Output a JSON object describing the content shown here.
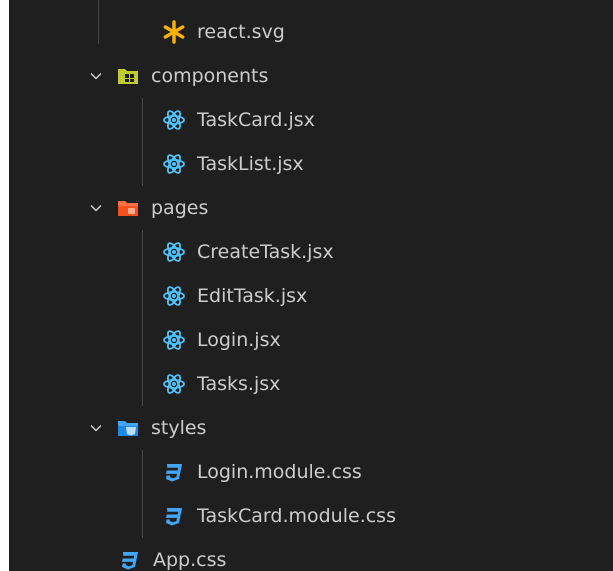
{
  "explorer": {
    "items": [
      {
        "label": "react.svg",
        "icon": "react-svg-asterisk-icon",
        "kind": "file"
      },
      {
        "label": "components",
        "icon": "folder-components-icon",
        "kind": "folder",
        "expanded": true
      },
      {
        "label": "TaskCard.jsx",
        "icon": "react-icon",
        "kind": "file"
      },
      {
        "label": "TaskList.jsx",
        "icon": "react-icon",
        "kind": "file"
      },
      {
        "label": "pages",
        "icon": "folder-pages-icon",
        "kind": "folder",
        "expanded": true
      },
      {
        "label": "CreateTask.jsx",
        "icon": "react-icon",
        "kind": "file"
      },
      {
        "label": "EditTask.jsx",
        "icon": "react-icon",
        "kind": "file"
      },
      {
        "label": "Login.jsx",
        "icon": "react-icon",
        "kind": "file"
      },
      {
        "label": "Tasks.jsx",
        "icon": "react-icon",
        "kind": "file"
      },
      {
        "label": "styles",
        "icon": "folder-styles-icon",
        "kind": "folder",
        "expanded": true
      },
      {
        "label": "Login.module.css",
        "icon": "css-icon",
        "kind": "file"
      },
      {
        "label": "TaskCard.module.css",
        "icon": "css-icon",
        "kind": "file"
      },
      {
        "label": "App.css",
        "icon": "css-icon",
        "kind": "file"
      }
    ]
  },
  "colors": {
    "background": "#1f1f1f",
    "text": "#cccccc",
    "react": "#4fc3f7",
    "css": "#42a5f5",
    "svg_asterisk": "#ffb300",
    "folder_components": "#c0ca33",
    "folder_pages": "#ff7043",
    "folder_styles": "#42a5f5"
  }
}
